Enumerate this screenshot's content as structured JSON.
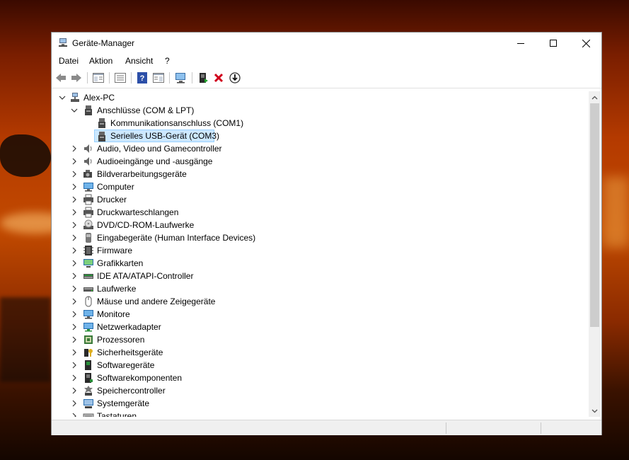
{
  "window": {
    "title": "Geräte-Manager"
  },
  "menu": [
    "Datei",
    "Aktion",
    "Ansicht",
    "?"
  ],
  "toolbar": {
    "buttons": [
      "back-arrow-icon",
      "forward-arrow-icon",
      "properties-pane-icon",
      "device-list-icon",
      "help-icon",
      "view-icon",
      "scan-hardware-icon",
      "update-driver-icon",
      "uninstall-icon",
      "download-icon"
    ]
  },
  "tree": {
    "root": "Alex-PC",
    "ports_group": "Anschlüsse (COM & LPT)",
    "port_children": [
      "Kommunikationsanschluss (COM1)",
      "Serielles USB-Gerät (COM3)"
    ],
    "categories": [
      "Audio, Video und Gamecontroller",
      "Audioeingänge und -ausgänge",
      "Bildverarbeitungsgeräte",
      "Computer",
      "Drucker",
      "Druckwarteschlangen",
      "DVD/CD-ROM-Laufwerke",
      "Eingabegeräte (Human Interface Devices)",
      "Firmware",
      "Grafikkarten",
      "IDE ATA/ATAPI-Controller",
      "Laufwerke",
      "Mäuse und andere Zeigegeräte",
      "Monitore",
      "Netzwerkadapter",
      "Prozessoren",
      "Sicherheitsgeräte",
      "Softwaregeräte",
      "Softwarekomponenten",
      "Speichercontroller",
      "Systemgeräte",
      "Tastaturen"
    ]
  },
  "colors": {
    "selection": "#cce8ff",
    "selection_border": "#99d1ff",
    "close_red": "#d0021b"
  }
}
